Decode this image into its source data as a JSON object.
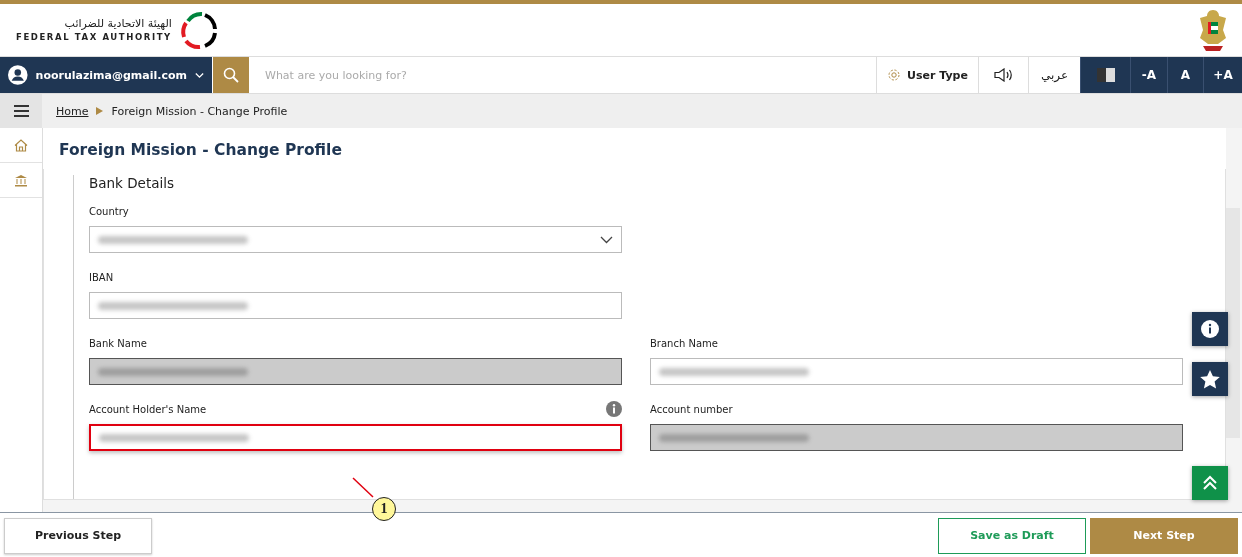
{
  "header": {
    "logo_arabic": "الهيئة الاتحادية للضرائب",
    "logo_english": "FEDERAL TAX AUTHORITY"
  },
  "navbar": {
    "user_email": "noorulazima@gmail.com",
    "search_placeholder": "What are you looking for?",
    "user_type": "User Type",
    "language": "عربي",
    "font_buttons": [
      "-A",
      "A",
      "+A"
    ]
  },
  "breadcrumb": [
    {
      "label": "Home",
      "kind": "link"
    },
    {
      "label": "Foreign Mission - Change Profile",
      "kind": "current"
    }
  ],
  "sidebar": {
    "items": [
      {
        "kind": "home",
        "selected": false
      },
      {
        "kind": "bank",
        "selected": false
      }
    ]
  },
  "page_title": "Foreign Mission - Change Profile",
  "section": {
    "title": "Bank Details",
    "rows": [
      [
        {
          "label": "Country",
          "kind": "select",
          "disabled": false,
          "highlighted": false,
          "info": false
        }
      ],
      [
        {
          "label": "IBAN",
          "kind": "text",
          "disabled": false,
          "highlighted": false,
          "info": false
        }
      ],
      [
        {
          "label": "Bank Name",
          "kind": "text",
          "disabled": true,
          "highlighted": false,
          "info": false
        },
        {
          "label": "Branch Name",
          "kind": "text",
          "disabled": false,
          "highlighted": false,
          "info": false
        }
      ],
      [
        {
          "label": "Account Holder's Name",
          "kind": "text",
          "disabled": false,
          "highlighted": true,
          "info": true
        },
        {
          "label": "Account number",
          "kind": "text",
          "disabled": true,
          "highlighted": false,
          "info": false
        }
      ]
    ]
  },
  "floating_buttons": [
    {
      "kind": "info"
    },
    {
      "kind": "star"
    },
    {
      "kind": "top"
    }
  ],
  "callout": {
    "label": "1"
  },
  "footer": {
    "previous": "Previous Step",
    "save": "Save as Draft",
    "next": "Next Step"
  }
}
